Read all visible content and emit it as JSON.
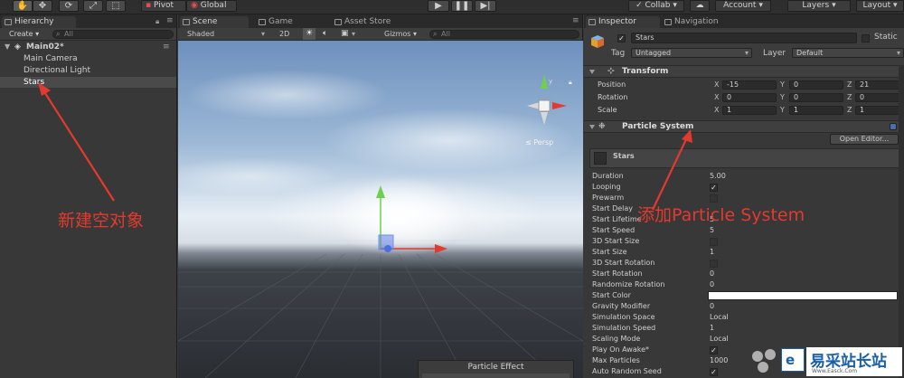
{
  "toolbar": {
    "pivot_label": "Pivot",
    "global_label": "Global",
    "collab_label": "Collab ▾",
    "account_label": "Account",
    "layers_label": "Layers",
    "layout_label": "Layout"
  },
  "hierarchy": {
    "tab_label": "Hierarchy",
    "create_label": "Create ▾",
    "search_placeholder": "All",
    "scene_name": "Main02*",
    "items": [
      {
        "label": "Main Camera"
      },
      {
        "label": "Directional Light"
      },
      {
        "label": "Stars"
      }
    ]
  },
  "scene": {
    "tabs": [
      {
        "label": "Scene"
      },
      {
        "label": "Game"
      },
      {
        "label": "Asset Store"
      }
    ],
    "shading_mode": "Shaded",
    "mode_2d": "2D",
    "gizmos_label": "Gizmos ▾",
    "search_placeholder": "All",
    "persp_label": "≤ Persp",
    "particle_effect_label": "Particle Effect"
  },
  "inspector": {
    "tabs": [
      {
        "label": "Inspector"
      },
      {
        "label": "Navigation"
      }
    ],
    "object_name": "Stars",
    "static_label": "Static",
    "tag_label": "Tag",
    "tag_value": "Untagged",
    "layer_label": "Layer",
    "layer_value": "Default",
    "transform": {
      "title": "Transform",
      "rows": [
        {
          "label": "Position",
          "x": "-15",
          "y": "0",
          "z": "21"
        },
        {
          "label": "Rotation",
          "x": "0",
          "y": "0",
          "z": "0"
        },
        {
          "label": "Scale",
          "x": "1",
          "y": "1",
          "z": "1"
        }
      ],
      "axis_x": "X",
      "axis_y": "Y",
      "axis_z": "Z"
    },
    "particle_system": {
      "title": "Particle System",
      "open_editor_label": "Open Editor...",
      "module_name": "Stars",
      "props": {
        "duration": {
          "label": "Duration",
          "value": "5.00"
        },
        "looping": {
          "label": "Looping"
        },
        "prewarm": {
          "label": "Prewarm"
        },
        "start_delay": {
          "label": "Start Delay"
        },
        "start_lifetime": {
          "label": "Start Lifetime",
          "value": "5"
        },
        "start_speed": {
          "label": "Start Speed",
          "value": "5"
        },
        "start_size_3d": {
          "label": "3D Start Size"
        },
        "start_size": {
          "label": "Start Size",
          "value": "1"
        },
        "start_rotation_3d": {
          "label": "3D Start Rotation"
        },
        "start_rotation": {
          "label": "Start Rotation",
          "value": "0"
        },
        "randomize_rotation": {
          "label": "Randomize Rotation",
          "value": "0"
        },
        "start_color": {
          "label": "Start Color"
        },
        "gravity_modifier": {
          "label": "Gravity Modifier",
          "value": "0"
        },
        "simulation_space": {
          "label": "Simulation Space",
          "value": "Local"
        },
        "simulation_speed": {
          "label": "Simulation Speed",
          "value": "1"
        },
        "scaling_mode": {
          "label": "Scaling Mode",
          "value": "Local"
        },
        "play_on_awake": {
          "label": "Play On Awake*"
        },
        "max_particles": {
          "label": "Max Particles",
          "value": "1000"
        },
        "auto_random_seed": {
          "label": "Auto Random Seed"
        }
      }
    }
  },
  "annotations": {
    "new_empty_object": "新建空对象",
    "add_particle_system": "添加Particle System"
  },
  "watermark": {
    "text": "易采站长站",
    "url": "Www.Easck.Com"
  },
  "colors": {
    "arrow_red": "#e23a2e",
    "gizmo_green": "#6fd04a",
    "gizmo_blue": "#4a6fe0"
  }
}
